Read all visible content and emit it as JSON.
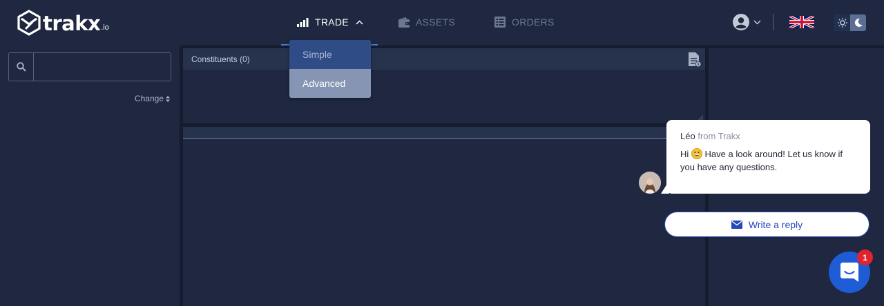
{
  "header": {
    "logo": {
      "text": "trakx",
      "suffix": ".io"
    },
    "nav": [
      {
        "label": "TRADE",
        "icon": "bar-chart-icon",
        "active": true
      },
      {
        "label": "ASSETS",
        "icon": "wallet-icon",
        "active": false
      },
      {
        "label": "ORDERS",
        "icon": "list-icon",
        "active": false
      }
    ],
    "trade_dropdown": [
      "Simple",
      "Advanced"
    ]
  },
  "sidebar": {
    "search": {
      "value": "",
      "placeholder": ""
    },
    "sort_label": "Change"
  },
  "panels": {
    "constituents_title": "Constituents (0)"
  },
  "chat": {
    "sender": "Léo",
    "sender_org": "from Trakx",
    "message_pre": "Hi",
    "message_post": "Have a look around! Let us know if you have any questions.",
    "reply_label": "Write a reply",
    "unread_count": "1"
  },
  "colors": {
    "background": "#1f2840",
    "accent": "#3d7fe0",
    "chat_blue": "#1e5cd6",
    "badge_red": "#e0232e"
  }
}
